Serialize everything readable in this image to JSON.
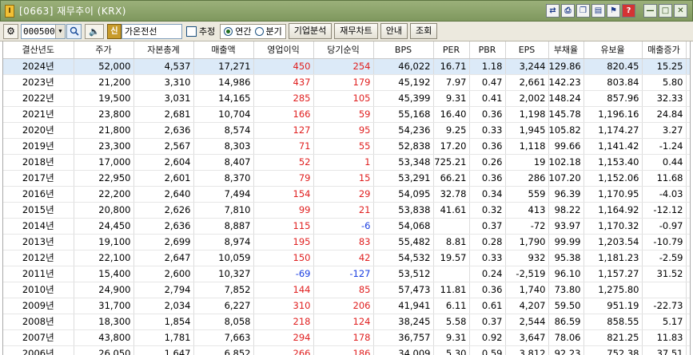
{
  "window": {
    "title": "[0663] 재무추이 (KRX)"
  },
  "toolbar": {
    "code_value": "000500",
    "badge": "신",
    "stock_name": "가온전선",
    "estimate_label": "추정",
    "radio_annual": "연간",
    "radio_quarter": "분기",
    "btn_company": "기업분석",
    "btn_chart": "재무차트",
    "btn_guide": "안내",
    "btn_query": "조회"
  },
  "table": {
    "columns": [
      "결산년도",
      "주가",
      "자본총계",
      "매출액",
      "영업이익",
      "당기순익",
      "BPS",
      "PER",
      "PBR",
      "EPS",
      "부채율",
      "유보율",
      "매출증가",
      "영익률"
    ],
    "rows": [
      [
        "2024년",
        "52,000",
        "4,537",
        "17,271",
        "450",
        "254",
        "46,022",
        "16.71",
        "1.18",
        "3,244",
        "129.86",
        "820.45",
        "15.25",
        "2.61"
      ],
      [
        "2023년",
        "21,200",
        "3,310",
        "14,986",
        "437",
        "179",
        "45,192",
        "7.97",
        "0.47",
        "2,661",
        "142.23",
        "803.84",
        "5.80",
        "2.92"
      ],
      [
        "2022년",
        "19,500",
        "3,031",
        "14,165",
        "285",
        "105",
        "45,399",
        "9.31",
        "0.41",
        "2,002",
        "148.24",
        "857.96",
        "32.33",
        "2.01"
      ],
      [
        "2021년",
        "23,800",
        "2,681",
        "10,704",
        "166",
        "59",
        "55,168",
        "16.40",
        "0.36",
        "1,198",
        "145.78",
        "1,196.16",
        "24.84",
        "1.55"
      ],
      [
        "2020년",
        "21,800",
        "2,636",
        "8,574",
        "127",
        "95",
        "54,236",
        "9.25",
        "0.33",
        "1,945",
        "105.82",
        "1,174.27",
        "3.27",
        "1.48"
      ],
      [
        "2019년",
        "23,300",
        "2,567",
        "8,303",
        "71",
        "55",
        "52,838",
        "17.20",
        "0.36",
        "1,118",
        "99.66",
        "1,141.42",
        "-1.24",
        "0.86"
      ],
      [
        "2018년",
        "17,000",
        "2,604",
        "8,407",
        "52",
        "1",
        "53,348",
        "725.21",
        "0.26",
        "19",
        "102.18",
        "1,153.40",
        "0.44",
        "0.62"
      ],
      [
        "2017년",
        "22,950",
        "2,601",
        "8,370",
        "79",
        "15",
        "53,291",
        "66.21",
        "0.36",
        "286",
        "107.20",
        "1,152.06",
        "11.68",
        "0.94"
      ],
      [
        "2016년",
        "22,200",
        "2,640",
        "7,494",
        "154",
        "29",
        "54,095",
        "32.78",
        "0.34",
        "559",
        "96.39",
        "1,170.95",
        "-4.03",
        "2.05"
      ],
      [
        "2015년",
        "20,800",
        "2,626",
        "7,810",
        "99",
        "21",
        "53,838",
        "41.61",
        "0.32",
        "413",
        "98.22",
        "1,164.92",
        "-12.12",
        "1.26"
      ],
      [
        "2014년",
        "24,450",
        "2,636",
        "8,887",
        "115",
        "-6",
        "54,068",
        "",
        "0.37",
        "-72",
        "93.97",
        "1,170.32",
        "-0.97",
        "1.29"
      ],
      [
        "2013년",
        "19,100",
        "2,699",
        "8,974",
        "195",
        "83",
        "55,482",
        "8.81",
        "0.28",
        "1,790",
        "99.99",
        "1,203.54",
        "-10.79",
        "2.17"
      ],
      [
        "2012년",
        "22,100",
        "2,647",
        "10,059",
        "150",
        "42",
        "54,532",
        "19.57",
        "0.33",
        "932",
        "95.38",
        "1,181.23",
        "-2.59",
        "1.49"
      ],
      [
        "2011년",
        "15,400",
        "2,600",
        "10,327",
        "-69",
        "-127",
        "53,512",
        "",
        "0.24",
        "-2,519",
        "96.10",
        "1,157.27",
        "31.52",
        "-0.66"
      ],
      [
        "2010년",
        "24,900",
        "2,794",
        "7,852",
        "144",
        "85",
        "57,473",
        "11.81",
        "0.36",
        "1,740",
        "73.80",
        "1,275.80",
        "",
        "1.84"
      ],
      [
        "2009년",
        "31,700",
        "2,034",
        "6,227",
        "310",
        "206",
        "41,941",
        "6.11",
        "0.61",
        "4,207",
        "59.50",
        "951.19",
        "-22.73",
        "4.98"
      ],
      [
        "2008년",
        "18,300",
        "1,854",
        "8,058",
        "218",
        "124",
        "38,245",
        "5.58",
        "0.37",
        "2,544",
        "86.59",
        "858.55",
        "5.17",
        "2.70"
      ],
      [
        "2007년",
        "43,800",
        "1,781",
        "7,663",
        "294",
        "178",
        "36,757",
        "9.31",
        "0.92",
        "3,647",
        "78.06",
        "821.25",
        "11.83",
        "3.84"
      ],
      [
        "2006년",
        "26,050",
        "1,647",
        "6,852",
        "266",
        "186",
        "34,009",
        "5.30",
        "0.59",
        "3,812",
        "92.23",
        "752.38",
        "37.51",
        "3.89"
      ]
    ]
  },
  "colors": {
    "positive": "#e02020",
    "negative": "#1a3ee0",
    "selected_row": "#dceaf8"
  }
}
